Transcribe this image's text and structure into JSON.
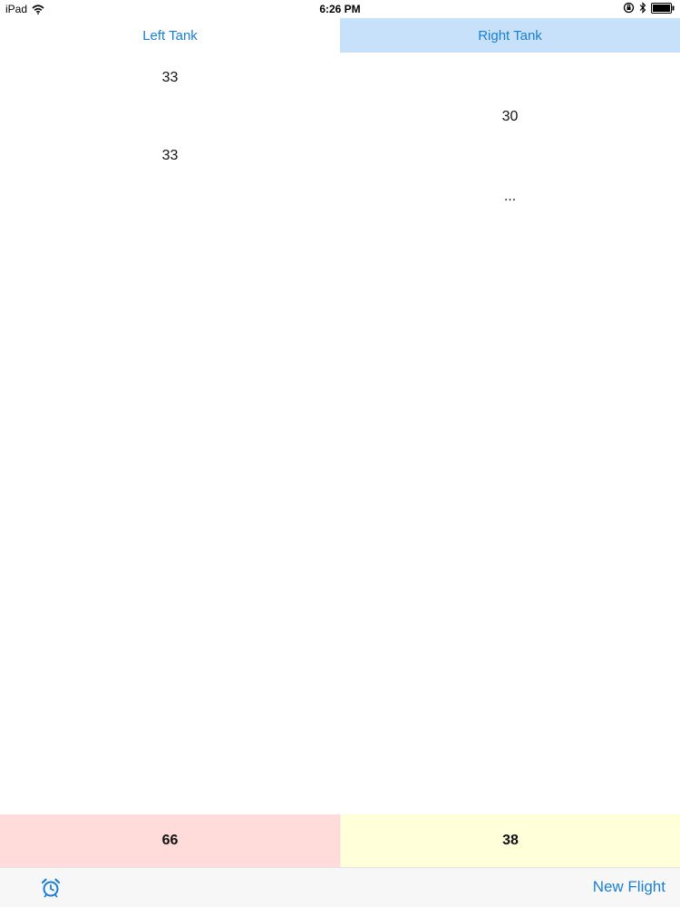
{
  "status_bar": {
    "device": "iPad",
    "time": "6:26 PM"
  },
  "tabs": [
    {
      "label": "Left Tank",
      "selected": false
    },
    {
      "label": "Right Tank",
      "selected": true
    }
  ],
  "left_column": {
    "readings": [
      "33",
      "33"
    ]
  },
  "right_column": {
    "readings": [
      "30",
      "..."
    ]
  },
  "totals": {
    "left": "66",
    "right": "38"
  },
  "toolbar": {
    "alarm_icon": "alarm-clock-icon",
    "new_flight_label": "New Flight"
  },
  "colors": {
    "accent": "#1a7fd4",
    "selected_tab_bg": "#c6e1f9",
    "left_total_bg": "#ffdcda",
    "right_total_bg": "#ffffd9"
  }
}
